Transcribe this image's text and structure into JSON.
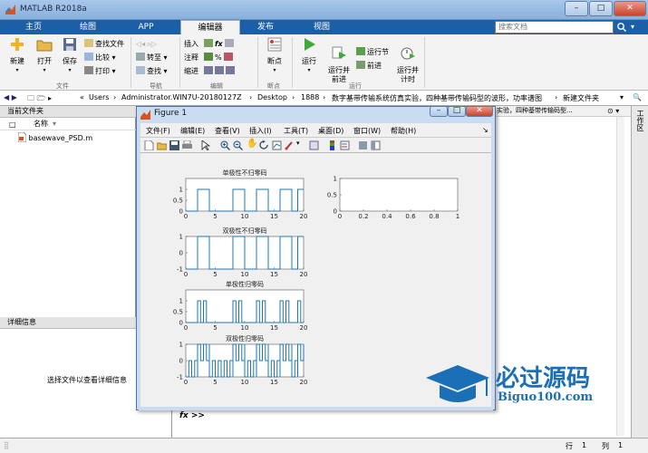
{
  "window": {
    "title": "MATLAB R2018a"
  },
  "tabs": [
    {
      "label": "主页",
      "active": false
    },
    {
      "label": "绘图",
      "active": false
    },
    {
      "label": "APP",
      "active": false
    },
    {
      "label": "编辑器",
      "active": true
    },
    {
      "label": "发布",
      "active": false
    },
    {
      "label": "视图",
      "active": false
    }
  ],
  "search": {
    "placeholder": "搜索文档"
  },
  "toolstrip": {
    "file": {
      "new": "新建",
      "open": "打开",
      "save": "保存",
      "find_files": "查找文件",
      "compare": "比较",
      "print": "打印",
      "group": "文件"
    },
    "nav": {
      "goto": "转至",
      "find": "查找",
      "group": "导航"
    },
    "edit": {
      "insert": "插入",
      "comment": "注释",
      "indent": "缩进",
      "fx": "fx",
      "group": "编辑"
    },
    "breakpoints": {
      "label": "断点",
      "group": "断点"
    },
    "run": {
      "run": "运行",
      "run_advance": "运行并\n前进",
      "run_section": "运行节",
      "advance": "前进",
      "run_time": "运行并\n计时",
      "group": "运行"
    }
  },
  "address": {
    "path": [
      "«",
      "Users",
      "Administrator.WIN7U-20180127Z",
      "Desktop",
      "1888",
      "数字基带传输系统仿真实验，四种基带传输码型的波形，功率谱图",
      "新建文件夹"
    ]
  },
  "current_folder": {
    "title": "当前文件夹",
    "col_name": "名称",
    "sort_indicator": "▾",
    "files": [
      {
        "name": "basewave_PSD.m"
      }
    ]
  },
  "details": {
    "title": "详细信息",
    "hint": "选择文件以查看详细信息"
  },
  "editor_tab_text": "实验，四种基带传输码型...",
  "workspace_label": "工作区",
  "command": {
    "prompt": "fx >>"
  },
  "status": {
    "row_label": "行",
    "row": "1",
    "col_label": "列",
    "col": "1"
  },
  "figure": {
    "title": "Figure 1",
    "menu": [
      "文件(F)",
      "编辑(E)",
      "查看(V)",
      "插入(I)",
      "工具(T)",
      "桌面(D)",
      "窗口(W)",
      "帮助(H)"
    ],
    "toolbar_icons": [
      "new-figure-icon",
      "open-icon",
      "save-icon",
      "print-icon",
      "pointer-icon",
      "zoom-in-icon",
      "zoom-out-icon",
      "pan-icon",
      "rotate-icon",
      "data-cursor-icon",
      "brush-icon",
      "link-icon",
      "colorbar-icon",
      "legend-icon",
      "hide-plot-tools-icon",
      "show-plot-tools-icon"
    ]
  },
  "watermark": {
    "brand": "必过源码",
    "domain": "Biguo100.com"
  },
  "colors": {
    "accent": "#1c5fa7",
    "plot_line": "#1f77b4",
    "watermark_blue": "#1a6fb5"
  },
  "chart_data": [
    {
      "type": "line",
      "title": "单极性不归零码",
      "xlim": [
        0,
        20
      ],
      "ylim": [
        0,
        1.5
      ],
      "xticks": [
        "0",
        "5",
        "10",
        "15",
        "20"
      ],
      "yticks": [
        "0",
        "0.5",
        "1"
      ],
      "x": [
        0,
        2,
        2,
        4,
        4,
        8,
        8,
        10,
        10,
        12,
        12,
        14,
        14,
        16,
        16,
        18,
        18,
        19,
        19,
        20
      ],
      "y": [
        0,
        0,
        1,
        1,
        0,
        0,
        1,
        1,
        0,
        0,
        1,
        1,
        0,
        0,
        1,
        1,
        0,
        0,
        1,
        1
      ]
    },
    {
      "type": "line",
      "title": "",
      "xlim": [
        0,
        1
      ],
      "ylim": [
        0,
        1
      ],
      "xticks": [
        "0",
        "0.2",
        "0.4",
        "0.6",
        "0.8",
        "1"
      ],
      "yticks": [
        "0",
        "0.5",
        "1"
      ],
      "x": [],
      "y": []
    },
    {
      "type": "line",
      "title": "双极性不归零码",
      "xlim": [
        0,
        20
      ],
      "ylim": [
        -1,
        1
      ],
      "xticks": [
        "0",
        "5",
        "10",
        "15",
        "20"
      ],
      "yticks": [
        "-1",
        "0",
        "1"
      ],
      "x": [
        0,
        2,
        2,
        4,
        4,
        8,
        8,
        10,
        10,
        12,
        12,
        14,
        14,
        16,
        16,
        18,
        18,
        19,
        19,
        20
      ],
      "y": [
        -1,
        -1,
        1,
        1,
        -1,
        -1,
        1,
        1,
        -1,
        -1,
        1,
        1,
        -1,
        -1,
        1,
        1,
        -1,
        -1,
        1,
        1
      ]
    },
    {
      "type": "line",
      "title": "单极性归零码",
      "xlim": [
        0,
        20
      ],
      "ylim": [
        0,
        1.5
      ],
      "xticks": [
        "0",
        "5",
        "10",
        "15",
        "20"
      ],
      "yticks": [
        "0",
        "0.5",
        "1"
      ],
      "pulses": [
        2,
        3,
        8,
        9,
        12,
        13,
        16,
        17,
        19
      ],
      "pulse_width": 0.5
    },
    {
      "type": "line",
      "title": "双极性归零码",
      "xlim": [
        0,
        20
      ],
      "ylim": [
        -1,
        1
      ],
      "xticks": [
        "0",
        "5",
        "10",
        "15",
        "20"
      ],
      "yticks": [
        "-1",
        "0",
        "1"
      ],
      "bits": [
        0,
        0,
        1,
        1,
        0,
        0,
        0,
        0,
        1,
        1,
        0,
        0,
        1,
        1,
        0,
        0,
        1,
        1,
        0,
        1
      ],
      "pulse_width": 0.5
    }
  ]
}
